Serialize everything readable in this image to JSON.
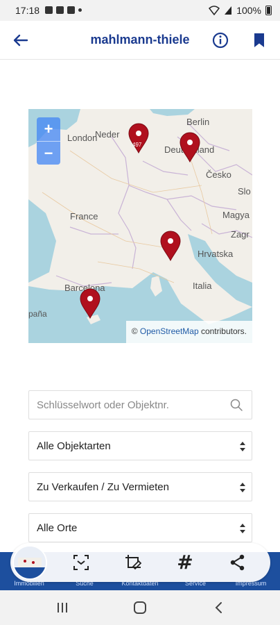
{
  "status_bar": {
    "time": "17:18",
    "battery": "100%"
  },
  "app_bar": {
    "title": "mahlmann-thiele",
    "back_icon": "arrow-left-icon",
    "info_icon": "info-circle-icon",
    "bookmark_icon": "bookmark-icon",
    "accent_color": "#1a3a8f"
  },
  "map": {
    "zoom_in": "+",
    "zoom_out": "−",
    "labels": {
      "london": "London",
      "nederland": "Neder",
      "deutschland": "Deutschland",
      "berlin": "Berlin",
      "cesko": "Česko",
      "slo": "Slo",
      "france": "France",
      "magya": "Magya",
      "zagr": "Zagr",
      "hrvatska": "Hrvatska",
      "italia": "Italia",
      "barcelona": "Barcelona",
      "espana": "paña",
      "marker_number": "497"
    },
    "attribution_prefix": "© ",
    "attribution_link": "OpenStreetMap",
    "attribution_suffix": " contributors.",
    "marker_color": "#b0101e"
  },
  "search": {
    "placeholder": "Schlüsselwort oder Objektnr."
  },
  "filters": {
    "type": "Alle Objektarten",
    "offer": "Zu Verkaufen / Zu Vermieten",
    "location": "Alle Orte"
  },
  "bottom_nav": {
    "items": [
      "Immobilien",
      "Suche",
      "Kontaktdaten",
      "Service",
      "Impressum"
    ],
    "color": "#1d4f9e"
  }
}
